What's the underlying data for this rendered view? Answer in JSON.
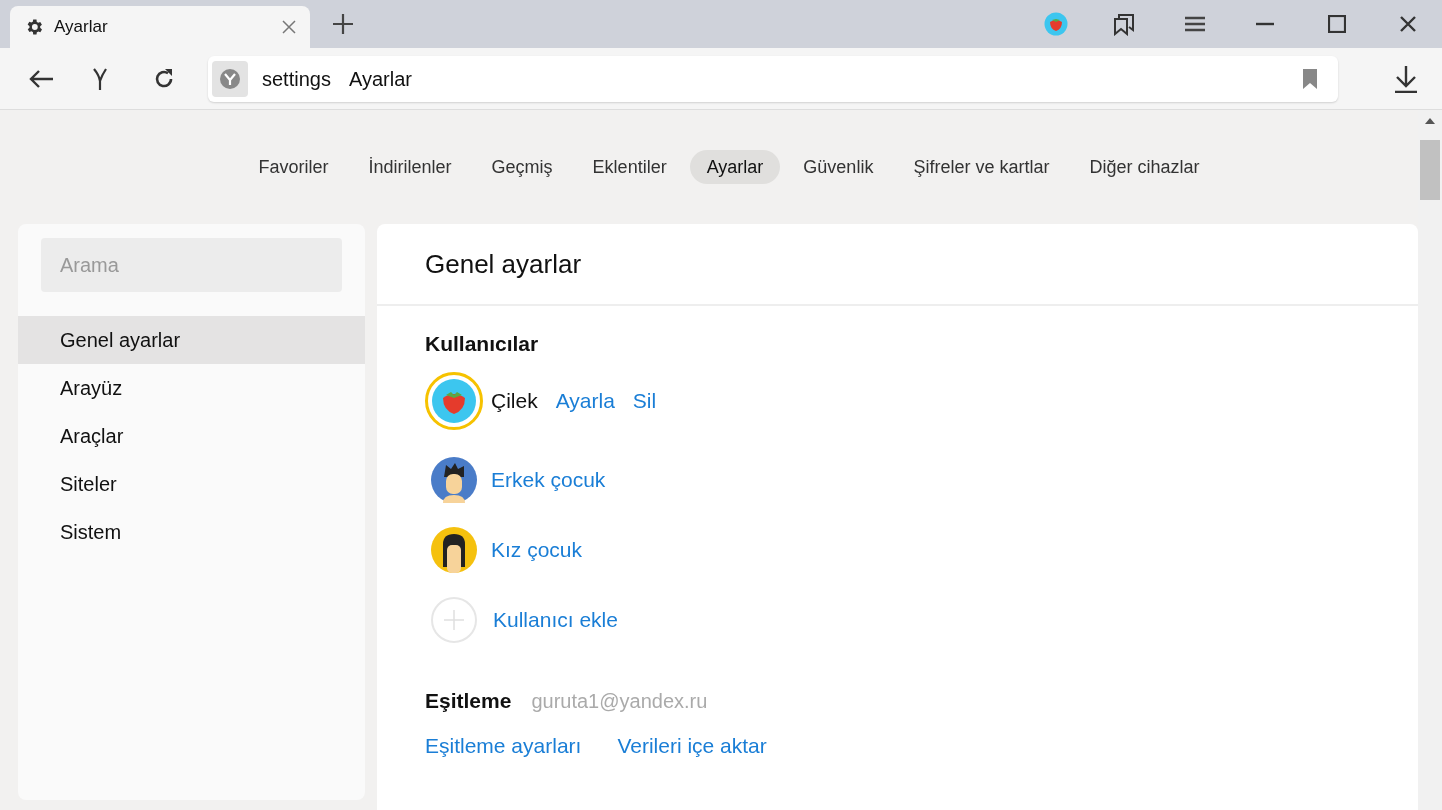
{
  "tab": {
    "title": "Ayarlar"
  },
  "address": {
    "host": "settings",
    "title": "Ayarlar"
  },
  "nav": [
    {
      "label": "Favoriler",
      "selected": false
    },
    {
      "label": "İndirilenler",
      "selected": false
    },
    {
      "label": "Geçmiş",
      "selected": false
    },
    {
      "label": "Eklentiler",
      "selected": false
    },
    {
      "label": "Ayarlar",
      "selected": true
    },
    {
      "label": "Güvenlik",
      "selected": false
    },
    {
      "label": "Şifreler ve kartlar",
      "selected": false
    },
    {
      "label": "Diğer cihazlar",
      "selected": false
    }
  ],
  "sidebar": {
    "search": {
      "placeholder": "Arama"
    },
    "items": [
      {
        "label": "Genel ayarlar",
        "selected": true
      },
      {
        "label": "Arayüz",
        "selected": false
      },
      {
        "label": "Araçlar",
        "selected": false
      },
      {
        "label": "Siteler",
        "selected": false
      },
      {
        "label": "Sistem",
        "selected": false
      }
    ]
  },
  "main": {
    "title": "Genel ayarlar",
    "users_heading": "Kullanıcılar",
    "users": [
      {
        "kind": "strawberry",
        "name": "Çilek",
        "selected": true,
        "actions": [
          "Ayarla",
          "Sil"
        ]
      },
      {
        "kind": "boy",
        "name": "Erkek çocuk",
        "selected": false
      },
      {
        "kind": "girl",
        "name": "Kız çocuk",
        "selected": false
      }
    ],
    "add_user": "Kullanıcı ekle",
    "sync_heading": "Eşitleme",
    "sync_account": "guruta1@yandex.ru",
    "sync_links": [
      "Eşitleme ayarları",
      "Verileri içe aktar"
    ]
  }
}
